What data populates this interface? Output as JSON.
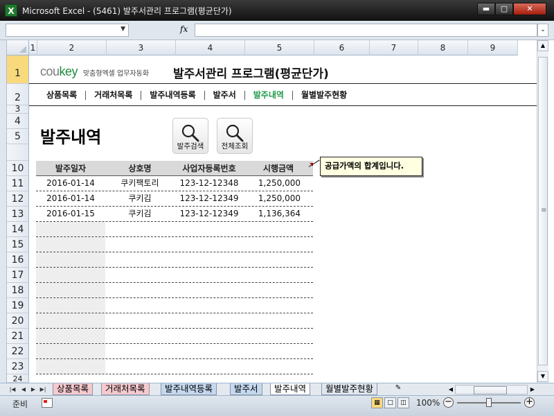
{
  "window": {
    "title": "Microsoft Excel - (5461) 발주서관리 프로그램(평균단가)",
    "app_icon": "excel-icon",
    "controls": [
      "minimize",
      "maximize",
      "close"
    ]
  },
  "formula_bar": {
    "name_box": "",
    "fx_label": "fx",
    "formula": ""
  },
  "columns": [
    "1",
    "2",
    "3",
    "4",
    "5",
    "6",
    "7",
    "8",
    "9"
  ],
  "rows": [
    "1",
    "2",
    "3",
    "4",
    "5",
    "10",
    "11",
    "12",
    "13",
    "14",
    "15",
    "16",
    "17",
    "18",
    "19",
    "20",
    "21",
    "22",
    "23",
    "24"
  ],
  "brand": {
    "logo_main": "cou",
    "logo_accent": "key",
    "tagline": "맞춤형엑셀 업무자동화",
    "app_title": "발주서관리 프로그램(평균단가)"
  },
  "nav": {
    "items": [
      "상품목록",
      "거래처목록",
      "발주내역등록",
      "발주서",
      "발주내역",
      "월별발주현황"
    ],
    "active": "발주내역"
  },
  "page": {
    "heading": "발주내역",
    "buttons": [
      "발주검색",
      "전체조회"
    ]
  },
  "table": {
    "headers": [
      "발주일자",
      "상호명",
      "사업자등록번호",
      "시행금액"
    ],
    "rows": [
      [
        "2016-01-14",
        "쿠키팩토리",
        "123-12-12348",
        "1,250,000"
      ],
      [
        "2016-01-14",
        "쿠키김",
        "123-12-12349",
        "1,250,000"
      ],
      [
        "2016-01-15",
        "쿠키김",
        "123-12-12349",
        "1,136,364"
      ]
    ]
  },
  "comment": {
    "text": "공급가액의 합계입니다."
  },
  "sheet_tabs": {
    "tabs": [
      "상품목록",
      "거래처목록",
      "발주내역등록",
      "발주서",
      "발주내역",
      "월별발주현황"
    ],
    "active": "발주내역"
  },
  "status": {
    "ready": "준비",
    "zoom": "100%",
    "view_mode": "normal"
  },
  "colors": {
    "brand_green": "#1e8a3f",
    "active_nav": "#1e9b4a",
    "table_header_bg": "#d9d9d9",
    "comment_bg": "#ffffe1"
  }
}
